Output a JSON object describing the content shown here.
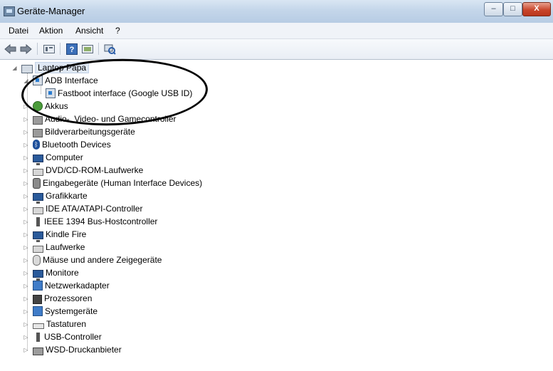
{
  "window": {
    "title": "Geräte-Manager",
    "controls": {
      "minimize": "–",
      "maximize": "□",
      "close": "X"
    }
  },
  "menu": {
    "items": [
      "Datei",
      "Aktion",
      "Ansicht",
      "?"
    ]
  },
  "toolbar": {
    "buttons": [
      "back-arrow-icon",
      "forward-arrow-icon",
      "properties-icon",
      "help-icon",
      "update-driver-icon",
      "scan-hardware-icon"
    ]
  },
  "tree": {
    "root": {
      "label": "Laptop Papa",
      "expanded": true
    },
    "adb": {
      "label": "ADB Interface",
      "expanded": true
    },
    "adb_child": {
      "label": "Fastboot interface (Google USB ID)"
    },
    "categories": [
      "Akkus",
      "Audio-, Video- und Gamecontroller",
      "Bildverarbeitungsgeräte",
      "Bluetooth Devices",
      "Computer",
      "DVD/CD-ROM-Laufwerke",
      "Eingabegeräte (Human Interface Devices)",
      "Grafikkarte",
      "IDE ATA/ATAPI-Controller",
      "IEEE 1394 Bus-Hostcontroller",
      "Kindle Fire",
      "Laufwerke",
      "Mäuse und andere Zeigegeräte",
      "Monitore",
      "Netzwerkadapter",
      "Prozessoren",
      "Systemgeräte",
      "Tastaturen",
      "USB-Controller",
      "WSD-Druckanbieter"
    ]
  },
  "colors": {
    "titlebar": "#c4d6ea",
    "annotation": "#000000"
  }
}
